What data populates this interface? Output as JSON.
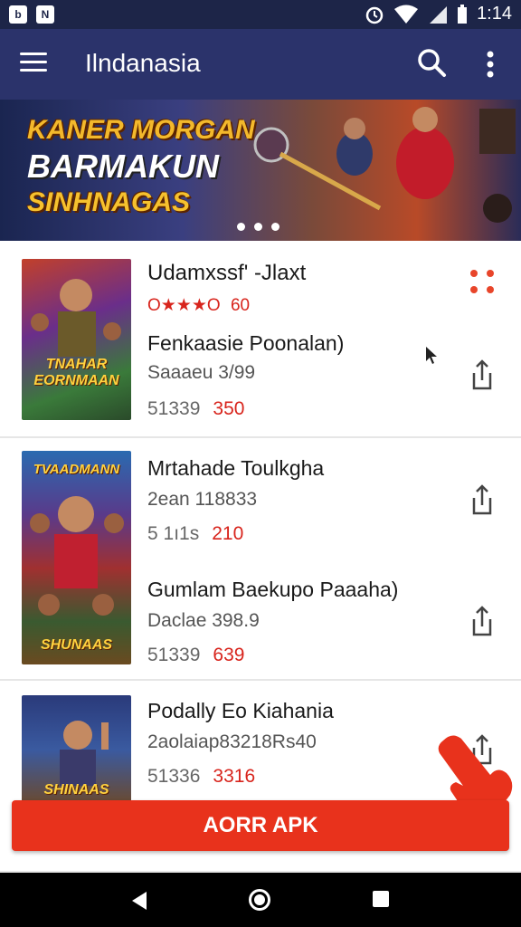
{
  "status_bar": {
    "time": "1:14",
    "left_icons": [
      "b-icon",
      "n-icon"
    ],
    "right_icons": [
      "alarm-icon",
      "wifi-icon",
      "signal-icon",
      "battery-icon"
    ]
  },
  "app_bar": {
    "title": "Ilndanasia"
  },
  "banner": {
    "lines": [
      "KANER MORGAN",
      "BARMAKUN",
      "SINHNAGAS"
    ],
    "page_indicator": {
      "count": 3
    }
  },
  "apps": [
    {
      "title": "Udamxssf' -Jlaxt",
      "rating": "O★★★O",
      "rating_count": "60",
      "subtitle": "Fenkaasie Poonalan)",
      "size": "Saaaeu 3/99",
      "price_old": "51339",
      "price_new": "350",
      "thumb_text": "TNAHAR EORNMAAN"
    },
    {
      "title": "Mrtahade Toulkgha",
      "meta": "2ean 118833",
      "price_old": "5 1ı1s",
      "price_new": "210",
      "subtitle2": "Gumlam Baekupo Paaaha)",
      "size": "Daclae 398.9",
      "price_old2": "51339",
      "price_new2": "639",
      "thumb_text_top": "TVAADMANN",
      "thumb_text_bottom": "SHUNAAS"
    },
    {
      "title": "Podally Eo Kiahania",
      "meta": "2aolaiap83218Rs40",
      "price_old": "51336",
      "price_new": "3316",
      "thumb_text": "SHINAAS"
    }
  ],
  "cta": {
    "label": "AORR APK"
  },
  "colors": {
    "status_bar": "#1d2548",
    "app_bar": "#2b336b",
    "accent_red": "#d8241c",
    "cta": "#e8321c"
  }
}
